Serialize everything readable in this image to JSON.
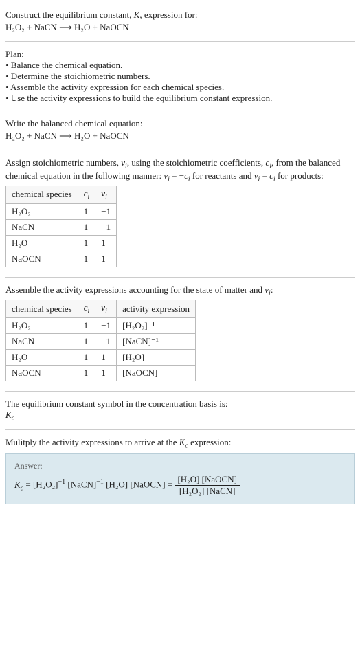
{
  "prompt": {
    "title": "Construct the equilibrium constant, K, expression for:",
    "equation": "H₂O₂ + NaCN  ⟶  H₂O + NaOCN"
  },
  "plan": {
    "heading": "Plan:",
    "items": [
      "• Balance the chemical equation.",
      "• Determine the stoichiometric numbers.",
      "• Assemble the activity expression for each chemical species.",
      "• Use the activity expressions to build the equilibrium constant expression."
    ]
  },
  "balanced": {
    "heading": "Write the balanced chemical equation:",
    "equation": "H₂O₂ + NaCN  ⟶  H₂O + NaOCN"
  },
  "stoich": {
    "heading": "Assign stoichiometric numbers, νᵢ, using the stoichiometric coefficients, cᵢ, from the balanced chemical equation in the following manner: νᵢ = −cᵢ for reactants and νᵢ = cᵢ for products:",
    "headers": [
      "chemical species",
      "cᵢ",
      "νᵢ"
    ],
    "rows": [
      {
        "species": "H₂O₂",
        "c": "1",
        "v": "−1"
      },
      {
        "species": "NaCN",
        "c": "1",
        "v": "−1"
      },
      {
        "species": "H₂O",
        "c": "1",
        "v": "1"
      },
      {
        "species": "NaOCN",
        "c": "1",
        "v": "1"
      }
    ]
  },
  "activity": {
    "heading": "Assemble the activity expressions accounting for the state of matter and νᵢ:",
    "headers": [
      "chemical species",
      "cᵢ",
      "νᵢ",
      "activity expression"
    ],
    "rows": [
      {
        "species": "H₂O₂",
        "c": "1",
        "v": "−1",
        "expr": "[H₂O₂]⁻¹"
      },
      {
        "species": "NaCN",
        "c": "1",
        "v": "−1",
        "expr": "[NaCN]⁻¹"
      },
      {
        "species": "H₂O",
        "c": "1",
        "v": "1",
        "expr": "[H₂O]"
      },
      {
        "species": "NaOCN",
        "c": "1",
        "v": "1",
        "expr": "[NaOCN]"
      }
    ]
  },
  "symbol": {
    "heading": "The equilibrium constant symbol in the concentration basis is:",
    "value": "K_c"
  },
  "multiply": {
    "heading": "Mulitply the activity expressions to arrive at the K_c expression:"
  },
  "answer": {
    "label": "Answer:",
    "expr_flat": "K_c = [H₂O₂]⁻¹ [NaCN]⁻¹ [H₂O] [NaOCN] = ",
    "frac_num": "[H₂O] [NaOCN]",
    "frac_den": "[H₂O₂] [NaCN]"
  },
  "chart_data": {
    "type": "table",
    "tables": [
      {
        "title": "Stoichiometric numbers",
        "columns": [
          "chemical species",
          "c_i",
          "ν_i"
        ],
        "rows": [
          [
            "H2O2",
            1,
            -1
          ],
          [
            "NaCN",
            1,
            -1
          ],
          [
            "H2O",
            1,
            1
          ],
          [
            "NaOCN",
            1,
            1
          ]
        ]
      },
      {
        "title": "Activity expressions",
        "columns": [
          "chemical species",
          "c_i",
          "ν_i",
          "activity expression"
        ],
        "rows": [
          [
            "H2O2",
            1,
            -1,
            "[H2O2]^-1"
          ],
          [
            "NaCN",
            1,
            -1,
            "[NaCN]^-1"
          ],
          [
            "H2O",
            1,
            1,
            "[H2O]"
          ],
          [
            "NaOCN",
            1,
            1,
            "[NaOCN]"
          ]
        ]
      }
    ]
  }
}
